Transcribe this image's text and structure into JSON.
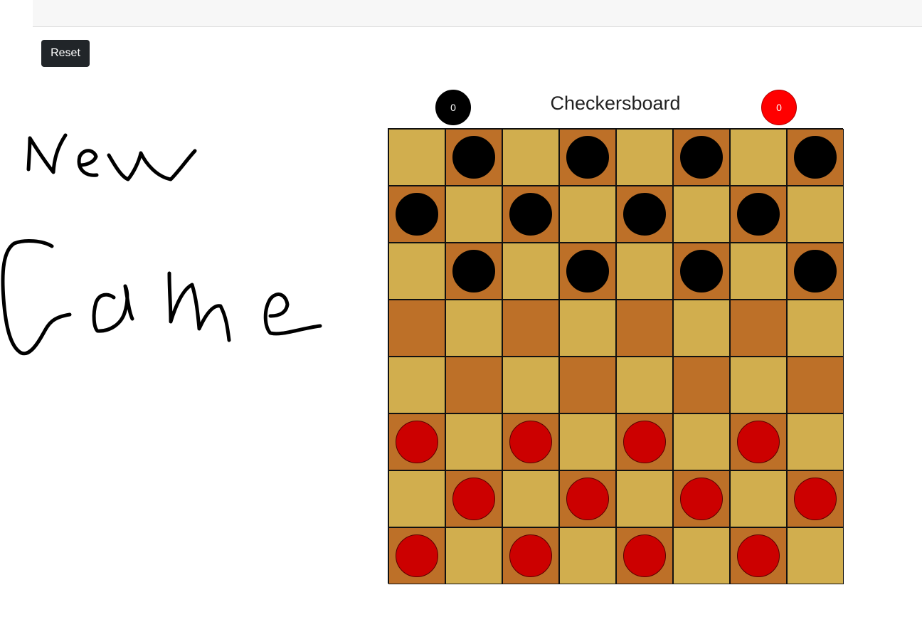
{
  "toolbar": {
    "reset_label": "Reset"
  },
  "handwriting": {
    "lines": [
      "New",
      "Game"
    ]
  },
  "game": {
    "title": "Checkersboard",
    "score_black": "0",
    "score_red": "0",
    "colors": {
      "light_square": "#d1ae4e",
      "dark_square": "#bd7028",
      "black_piece": "#000000",
      "red_piece": "#cc0000",
      "red_score_badge": "#ff0000"
    },
    "board": [
      [
        "",
        "b",
        "",
        "b",
        "",
        "b",
        "",
        "b"
      ],
      [
        "b",
        "",
        "b",
        "",
        "b",
        "",
        "b",
        ""
      ],
      [
        "",
        "b",
        "",
        "b",
        "",
        "b",
        "",
        "b"
      ],
      [
        "",
        "",
        "",
        "",
        "",
        "",
        "",
        ""
      ],
      [
        "",
        "",
        "",
        "",
        "",
        "",
        "",
        ""
      ],
      [
        "r",
        "",
        "r",
        "",
        "r",
        "",
        "r",
        ""
      ],
      [
        "",
        "r",
        "",
        "r",
        "",
        "r",
        "",
        "r"
      ],
      [
        "r",
        "",
        "r",
        "",
        "r",
        "",
        "r",
        ""
      ]
    ]
  }
}
